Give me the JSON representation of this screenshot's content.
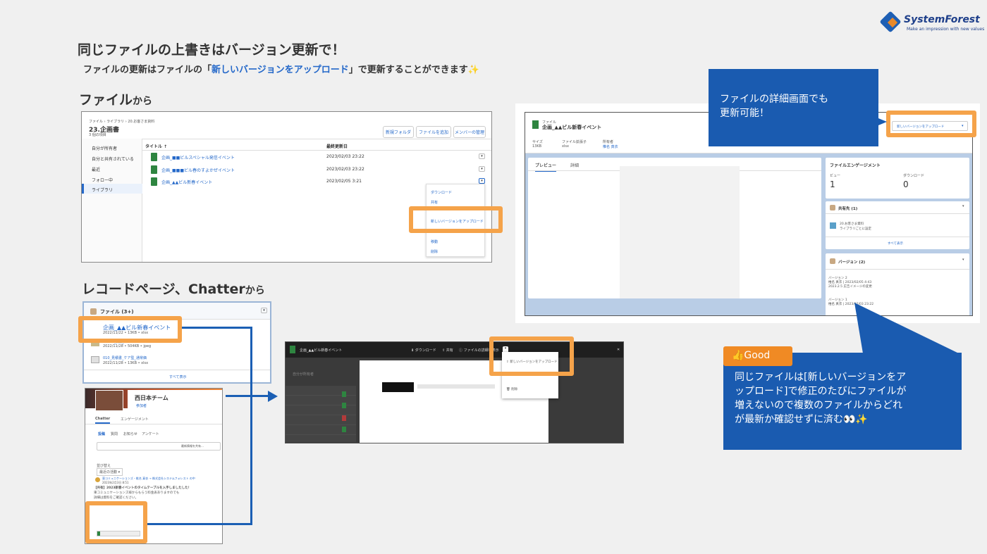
{
  "logo": {
    "name": "SystemForest",
    "tagline": "Make an impression with new values"
  },
  "heading": {
    "title": "同じファイルの上書きはバージョン更新で！",
    "sub_prefix": "ファイルの更新はファイルの「",
    "sub_highlight": "新しいバージョンをアップロード",
    "sub_suffix": "」で更新することができます✨"
  },
  "section_file": {
    "title": "ファイル",
    "suffix": "から"
  },
  "section_record": {
    "title": "レコードページ、Chatter",
    "suffix": "から"
  },
  "files_panel": {
    "breadcrumb": "ファイル › ライブラリ › 20.お客さま資料",
    "folder": "23.企画書",
    "count": "3 個の項目",
    "buttons": [
      "新規フォルダ",
      "ファイルを追加",
      "メンバーの管理"
    ],
    "sidebar": [
      "自分が所有者",
      "自分と共有されている",
      "最近",
      "フォロー中",
      "ライブラリ"
    ],
    "col_title": "タイトル ↑",
    "col_modified": "最終更新日",
    "rows": [
      {
        "name": "企画_■■ビルスペシャル発信イベント",
        "date": "2023/02/03 23:22"
      },
      {
        "name": "企画_■■■ビル春のすよかぜイベント",
        "date": "2023/02/03 23:22"
      },
      {
        "name": "企画_▲▲ビル新春イベント",
        "date": "2023/02/05 3:21"
      }
    ],
    "menu": [
      "ダウンロード",
      "共有",
      "新しいバージョンをアップロード",
      "移動",
      "削除"
    ]
  },
  "record_panel": {
    "header": "ファイル (3+)",
    "items": [
      {
        "name": "企画_▲▲ビル新春イベント",
        "meta": "2022/11/22 • 13KB • xlsx"
      },
      {
        "name": "00000_(補)_1",
        "meta": "2022/11/28 • 504KB • jpeg"
      },
      {
        "name": "010_見積書_ケア型_通常価",
        "meta": "2022/11/28 • 13KB • xlsx"
      }
    ],
    "view_all": "すべて表示"
  },
  "chatter_panel": {
    "group": "西日本チーム",
    "member": "参加者",
    "tabs": [
      "Chatter",
      "エンゲージメント"
    ],
    "subtabs": [
      "投稿",
      "質問",
      "お知らせ",
      "アンケート"
    ],
    "share_placeholder": "最新情報を共有…",
    "sort_label": "並び替え",
    "sort_value": "最近の活動",
    "post_author": "東コミュニケーションズ・椎名 真衣 → 株式会社システムフォレスト の中",
    "post_time": "2023年2月3日 8:51",
    "post_body1": "【共有】2023新春イベントのタイムテーブルを入手しましたした！",
    "post_body2": "東コミュニケーションズ様からもらう料金表ありますのでも",
    "post_body3": "詳細は資料をご確認ください。"
  },
  "preview_panel": {
    "file": "企画_▲▲ビル新春イベント",
    "actions": [
      "ダウンロード",
      "共有",
      "ファイルの詳細を表示"
    ],
    "folder": "自分が所有者",
    "menu": [
      "新しいバージョンをアップロード",
      "削除"
    ]
  },
  "detail_panel": {
    "label": "ファイル",
    "title": "企画_▲▲ビル新春イベント",
    "fields": [
      {
        "label": "サイズ",
        "value": "13KB"
      },
      {
        "label": "ファイル拡張子",
        "value": "xlsx"
      },
      {
        "label": "所有者",
        "value": "椎名 真衣"
      }
    ],
    "upload_button": "新しいバージョンをアップロード",
    "tabs": [
      "プレビュー",
      "詳細"
    ],
    "engagement_title": "ファイルエンゲージメント",
    "views_label": "ビュー",
    "views": "1",
    "downloads_label": "ダウンロード",
    "downloads": "0",
    "shared_title": "共有先 (1)",
    "shared_name": "20.お客さま資料",
    "shared_sub": "ライブラリごとに設定",
    "view_all": "すべて表示",
    "versions_title": "バージョン (2)",
    "v2_title": "バージョン 2",
    "v2_meta": "椎名 真衣 | 2023/02/05 4:43",
    "v2_note": "2023.2.5 広告イメージの変更",
    "v1_title": "バージョン 1",
    "v1_meta": "椎名 真衣 | 2023/02/03 23:22"
  },
  "callout_top": {
    "line1": "ファイルの詳細画面でも",
    "line2": "更新可能！"
  },
  "callout_good": {
    "badge": "👍Good",
    "line1": "同じファイルは[新しいバージョンをア",
    "line2": "ップロード]で修正のたびにファイルが",
    "line3": "増えないので複数のファイルからどれ",
    "line4": "が最新か確認せずに済む👀✨"
  },
  "colors": {
    "accent": "#f5a34a",
    "brand_blue": "#1a5bb0",
    "link": "#2468c9"
  }
}
